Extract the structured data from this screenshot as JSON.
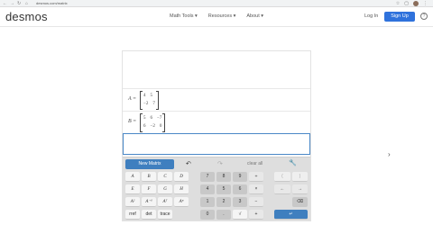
{
  "browser": {
    "address": "desmos.com/matrix"
  },
  "header": {
    "logo": "desmos",
    "nav": [
      "Math Tools ▾",
      "Resources ▾",
      "About ▾"
    ],
    "login": "Log In",
    "signup": "Sign Up",
    "help": "?"
  },
  "expressions": {
    "a_label": "A =",
    "a_rows": [
      [
        "4",
        "5"
      ],
      [
        "−2",
        "7"
      ]
    ],
    "b_label": "B =",
    "b_rows": [
      [
        "5",
        "6",
        "−7"
      ],
      [
        "6",
        "−2",
        "0"
      ]
    ]
  },
  "keypad": {
    "new_matrix": "New Matrix",
    "undo": "↶",
    "redo": "↷",
    "clear": "clear all",
    "wrench": "🔧",
    "letters": [
      "A",
      "B",
      "C",
      "D",
      "E",
      "F",
      "G",
      "H"
    ],
    "powers": [
      "A²",
      "A⁻¹",
      "Aᵀ",
      "Aⁿ"
    ],
    "functions": [
      "rref",
      "det",
      "trace"
    ],
    "digits": [
      "7",
      "8",
      "9",
      "4",
      "5",
      "6",
      "1",
      "2",
      "3",
      "0",
      "."
    ],
    "ops": [
      "÷",
      "×",
      "−",
      "+"
    ],
    "sqrt": "√",
    "paren_l": "(",
    "paren_r": ")",
    "arrow_l": "←",
    "arrow_r": "→",
    "backspace": "⌫",
    "enter": "↵"
  },
  "colors": {
    "accent": "#3f7fbf",
    "signup": "#2f72dc"
  }
}
